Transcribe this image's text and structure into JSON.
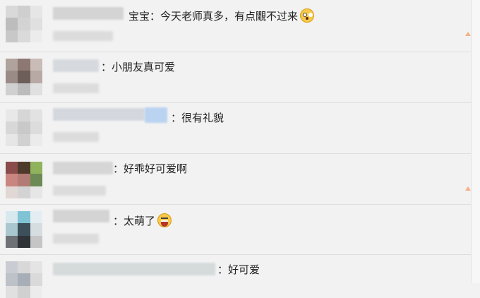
{
  "comments": [
    {
      "name_visible": "宝宝",
      "separator": "：",
      "text": "今天老师真多，有点覵不过来",
      "emoji": "shocked-face-icon"
    },
    {
      "name_visible": "",
      "separator": "：",
      "text": "小朋友真可爱",
      "emoji": ""
    },
    {
      "name_visible": "",
      "separator": "：",
      "text": "很有礼貌",
      "emoji": ""
    },
    {
      "name_visible": "",
      "separator": "：",
      "text": "好乖好可爱啊",
      "emoji": ""
    },
    {
      "name_visible": "",
      "separator": "：",
      "text": "太萌了",
      "emoji": "laughing-face-icon"
    },
    {
      "name_visible": "",
      "separator": "：",
      "text": "好可爱",
      "emoji": ""
    }
  ],
  "colors": {
    "background": "#f2f2f2",
    "divider": "#dedede",
    "report_marker": "#f4b183"
  }
}
